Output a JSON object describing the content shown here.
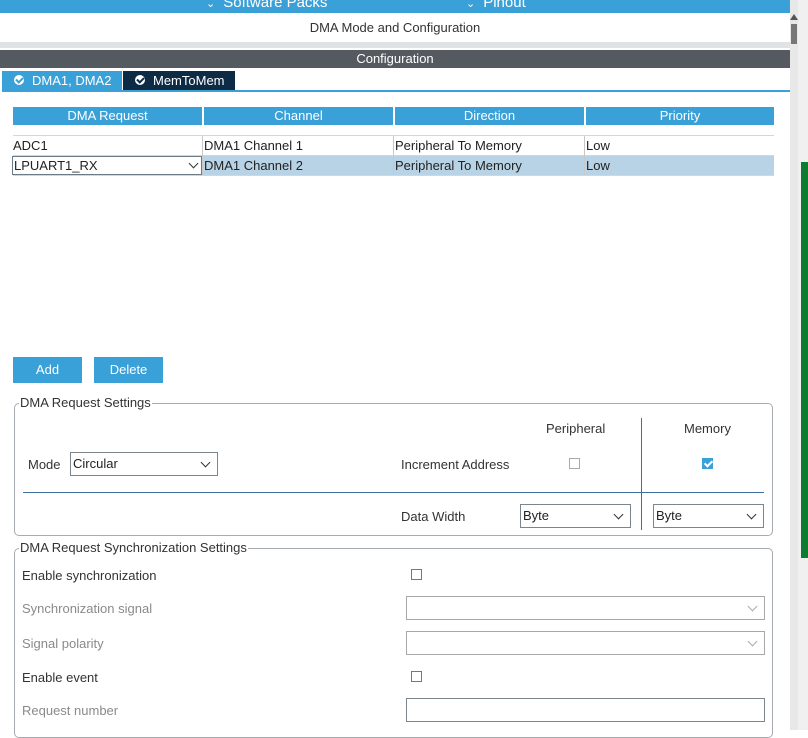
{
  "topbar": {
    "software_packs": "Software Packs",
    "pinout": "Pinout"
  },
  "section_title": "DMA Mode and Configuration",
  "config_bar": "Configuration",
  "tabs": [
    {
      "label": "DMA1, DMA2"
    },
    {
      "label": "MemToMem"
    }
  ],
  "table": {
    "headers": [
      "DMA Request",
      "Channel",
      "Direction",
      "Priority"
    ],
    "rows": [
      {
        "request": "ADC1",
        "channel": "DMA1 Channel 1",
        "direction": "Peripheral To Memory",
        "priority": "Low",
        "selected": false
      },
      {
        "request": "LPUART1_RX",
        "channel": "DMA1 Channel 2",
        "direction": "Peripheral To Memory",
        "priority": "Low",
        "selected": true
      }
    ]
  },
  "buttons": {
    "add": "Add",
    "delete": "Delete"
  },
  "request_settings": {
    "legend": "DMA Request Settings",
    "mode_label": "Mode",
    "mode_value": "Circular",
    "peripheral_header": "Peripheral",
    "memory_header": "Memory",
    "increment_label": "Increment Address",
    "increment_peripheral": false,
    "increment_memory": true,
    "data_width_label": "Data Width",
    "peripheral_width": "Byte",
    "memory_width": "Byte"
  },
  "sync_settings": {
    "legend": "DMA Request Synchronization Settings",
    "enable_sync_label": "Enable synchronization",
    "enable_sync": false,
    "sync_signal_label": "Synchronization signal",
    "sync_signal_value": "",
    "signal_polarity_label": "Signal polarity",
    "signal_polarity_value": "",
    "enable_event_label": "Enable event",
    "enable_event": false,
    "request_number_label": "Request number",
    "request_number_value": ""
  },
  "colors": {
    "accent": "#3aa1d8",
    "dark_tab": "#0e2b46",
    "config_bar": "#555a60",
    "selected_row": "#b8d3e6"
  }
}
